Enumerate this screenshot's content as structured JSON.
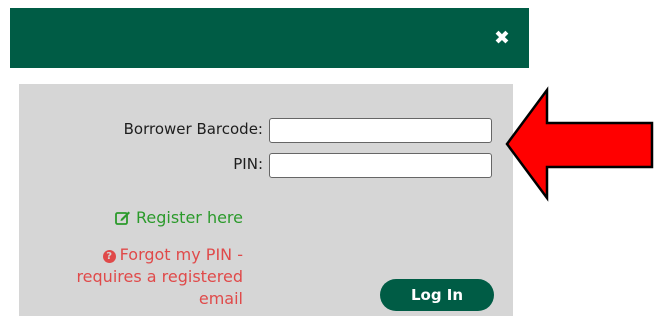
{
  "header": {
    "close_label": "✖"
  },
  "form": {
    "barcode_label": "Borrower Barcode:",
    "barcode_value": "",
    "pin_label": "PIN:",
    "pin_value": ""
  },
  "links": {
    "register_label": "Register here",
    "forgot_label": "Forgot my PIN - requires a registered email"
  },
  "actions": {
    "login_label": "Log In"
  },
  "icons": {
    "close": "close-icon",
    "register": "edit-icon",
    "forgot": "question-circle-icon",
    "annotation": "red-arrow-icon"
  },
  "colors": {
    "brand_green": "#005c45",
    "panel_bg": "#d6d6d6",
    "register_green": "#2b9a2b",
    "forgot_red": "#e04a4a",
    "arrow_red": "#ff0000"
  }
}
